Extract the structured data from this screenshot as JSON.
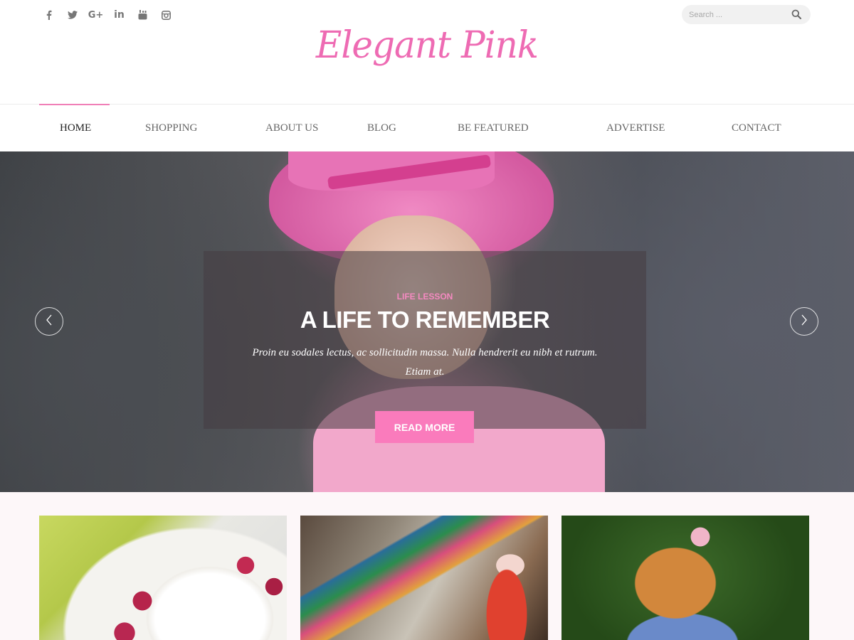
{
  "site": {
    "logo": "Elegant Pink"
  },
  "social": {
    "items": [
      {
        "name": "facebook-icon"
      },
      {
        "name": "twitter-icon"
      },
      {
        "name": "google-plus-icon",
        "label": "G+"
      },
      {
        "name": "linkedin-icon",
        "label": "in"
      },
      {
        "name": "youtube-icon"
      },
      {
        "name": "instagram-icon"
      }
    ]
  },
  "search": {
    "placeholder": "Search ..."
  },
  "nav": {
    "items": [
      {
        "label": "HOME",
        "active": true
      },
      {
        "label": "SHOPPING"
      },
      {
        "label": "ABOUT US"
      },
      {
        "label": "BLOG"
      },
      {
        "label": "BE FEATURED"
      },
      {
        "label": "ADVERTISE"
      },
      {
        "label": "CONTACT"
      }
    ]
  },
  "slider": {
    "category": "LIFE LESSON",
    "title": "A LIFE TO REMEMBER",
    "excerpt": "Proin eu sodales lectus, ac sollicitudin massa. Nulla hendrerit eu nibh et rutrum. Etiam at.",
    "button": "READ MORE"
  },
  "colors": {
    "accent": "#f07fb7",
    "logo": "#ee6bb3",
    "button": "#fa7bbc",
    "category": "#f48ac1"
  }
}
